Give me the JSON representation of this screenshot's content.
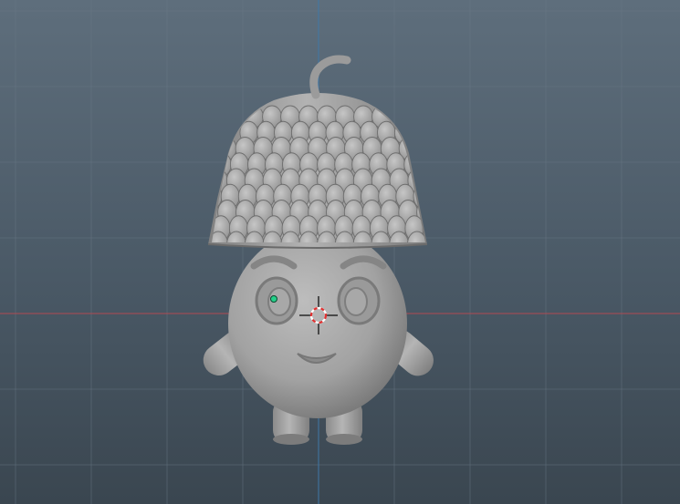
{
  "viewport": {
    "background_top": "#5e6e7c",
    "background_bottom": "#3a4650",
    "grid_color": "#6a7986",
    "x_axis_color": "#b04a52",
    "y_axis_color": "#3f78a8"
  },
  "model": {
    "material_color": "#a3a3a3",
    "shadow_color": "#6f6f6f",
    "highlight_color": "#c4c4c4"
  },
  "cursor_3d": {
    "ring_red": "#e03030",
    "ring_white": "#ffffff",
    "crosshair": "#111111"
  },
  "pivot_point": {
    "color": "#25d08a"
  }
}
